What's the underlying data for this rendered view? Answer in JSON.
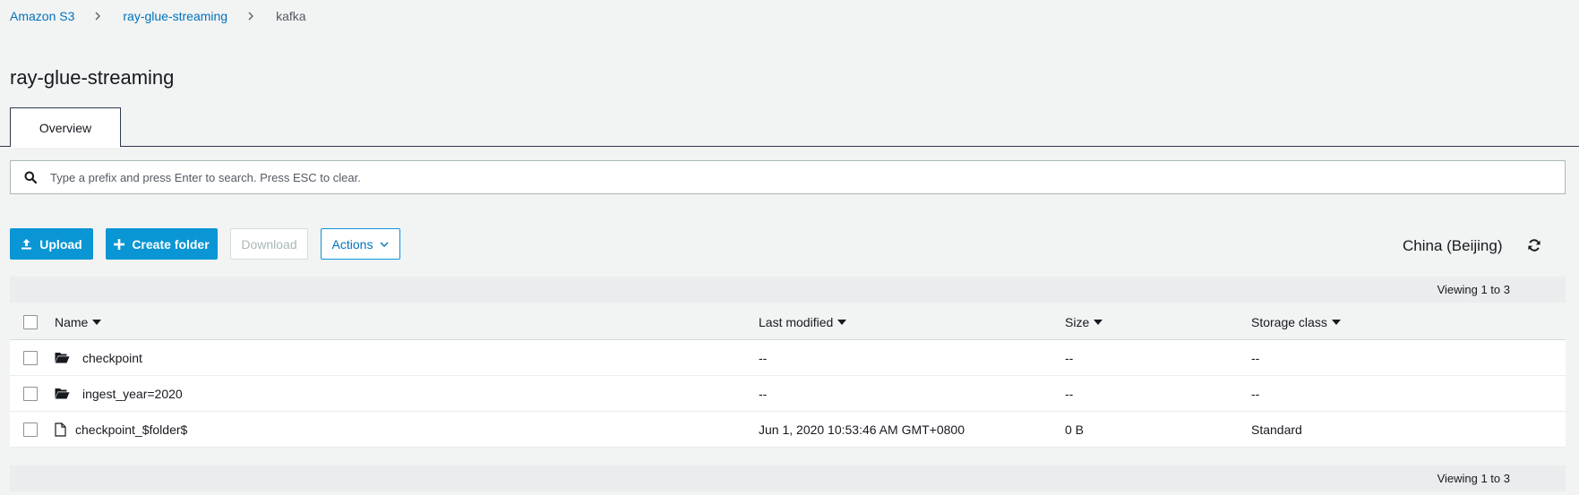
{
  "breadcrumb": {
    "items": [
      "Amazon S3",
      "ray-glue-streaming"
    ],
    "current": "kafka"
  },
  "page": {
    "title": "ray-glue-streaming"
  },
  "tabs": [
    {
      "label": "Overview"
    }
  ],
  "search": {
    "placeholder": "Type a prefix and press Enter to search. Press ESC to clear.",
    "value": ""
  },
  "toolbar": {
    "upload_label": "Upload",
    "create_folder_label": "Create folder",
    "download_label": "Download",
    "actions_label": "Actions"
  },
  "region": "China (Beijing)",
  "viewing": {
    "top": "Viewing 1 to 3",
    "bottom": "Viewing 1 to 3"
  },
  "table": {
    "headers": {
      "name": "Name",
      "last_modified": "Last modified",
      "size": "Size",
      "storage_class": "Storage class"
    },
    "rows": [
      {
        "type": "folder",
        "name": "checkpoint",
        "last_modified": "--",
        "size": "--",
        "storage_class": "--"
      },
      {
        "type": "folder",
        "name": "ingest_year=2020",
        "last_modified": "--",
        "size": "--",
        "storage_class": "--"
      },
      {
        "type": "file",
        "name": "checkpoint_$folder$",
        "last_modified": "Jun 1, 2020 10:53:46 AM GMT+0800",
        "size": "0 B",
        "storage_class": "Standard"
      }
    ]
  },
  "colors": {
    "primary": "#0a96d4",
    "link": "#0073bb",
    "background": "#f2f3f3"
  }
}
